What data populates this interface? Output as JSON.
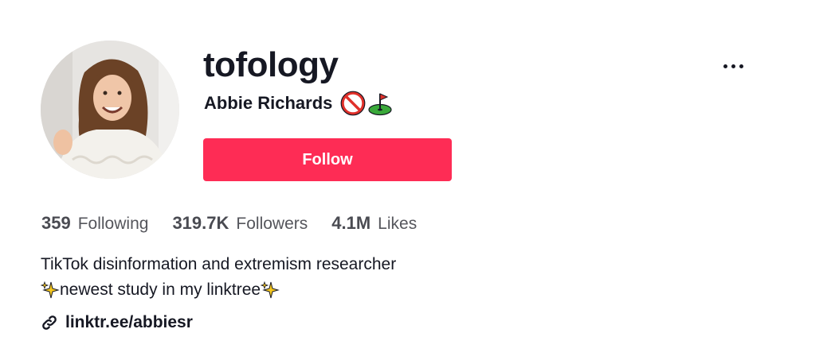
{
  "profile": {
    "username": "tofology",
    "display_name": "Abbie Richards",
    "display_name_emojis": [
      "prohibited-emoji",
      "golf-flag-emoji"
    ],
    "avatar": "profile-photo"
  },
  "actions": {
    "follow_label": "Follow",
    "more_icon": "more-dots-icon"
  },
  "stats": [
    {
      "value": "359",
      "label": "Following"
    },
    {
      "value": "319.7K",
      "label": "Followers"
    },
    {
      "value": "4.1M",
      "label": "Likes"
    }
  ],
  "bio": {
    "line1": "TikTok disinformation and extremism researcher",
    "line2": "newest study in my linktree"
  },
  "link": {
    "icon": "link-icon",
    "text": "linktr.ee/abbiesr"
  },
  "colors": {
    "accent": "#fe2c55",
    "text": "#161823",
    "muted": "#55565c"
  }
}
